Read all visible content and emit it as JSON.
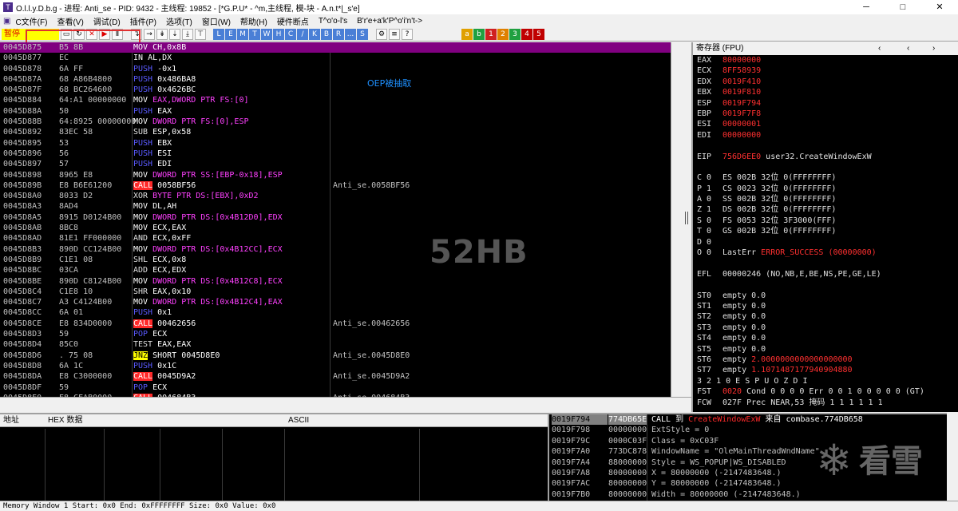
{
  "window": {
    "title": "O.l.l.y.D.b.g - 进程: Anti_se - PID: 9432 - 主线程: 19852 - [*G.P.U* - ^m,主线程, 模-块 - A.n.t*|_s'e]",
    "minimize": "─",
    "maximize": "□",
    "close": "✕"
  },
  "menu": {
    "items": [
      "C文件(F)",
      "查看(V)",
      "调试(D)",
      "插件(P)",
      "选项(T)",
      "窗口(W)",
      "帮助(H)",
      "硬件断点",
      "T^o'o-l's",
      "B'r'e+a'k'P^o'i'n't->"
    ]
  },
  "toolbar": {
    "status": "暂停",
    "letters": [
      "L",
      "E",
      "M",
      "T",
      "W",
      "H",
      "C",
      "/",
      "K",
      "B",
      "R",
      "...",
      "S"
    ],
    "colored": [
      "a",
      "b",
      "1",
      "2",
      "3",
      "4",
      "5"
    ]
  },
  "disasm": {
    "annotation": "OEP被抽取",
    "watermark": "52HB",
    "rows": [
      {
        "addr": "0045D875",
        "hex": "B5 8B",
        "mn": "MOV",
        "ops": "CH,0x8B",
        "cmt": "",
        "cls": "mov",
        "sel": true
      },
      {
        "addr": "0045D877",
        "hex": "EC",
        "mn": "IN",
        "ops": "AL,DX",
        "cmt": "",
        "cls": "mov"
      },
      {
        "addr": "0045D878",
        "hex": "6A FF",
        "mn": "PUSH",
        "ops": "-0x1",
        "cmt": "",
        "cls": "push"
      },
      {
        "addr": "0045D87A",
        "hex": "68 A86B4800",
        "mn": "PUSH",
        "ops": "0x486BA8",
        "cmt": "",
        "cls": "push"
      },
      {
        "addr": "0045D87F",
        "hex": "68 BC264600",
        "mn": "PUSH",
        "ops": "0x4626BC",
        "cmt": "",
        "cls": "push"
      },
      {
        "addr": "0045D884",
        "hex": "64:A1 00000000",
        "mn": "MOV",
        "ops": "EAX,DWORD PTR FS:[0]",
        "cmt": "",
        "cls": "mov",
        "mem": true
      },
      {
        "addr": "0045D88A",
        "hex": "50",
        "mn": "PUSH",
        "ops": "EAX",
        "cmt": "",
        "cls": "push"
      },
      {
        "addr": "0045D88B",
        "hex": "64:8925 00000000",
        "mn": "MOV",
        "ops": "DWORD PTR FS:[0],ESP",
        "cmt": "",
        "cls": "mov",
        "mem": true
      },
      {
        "addr": "0045D892",
        "hex": "83EC 58",
        "mn": "SUB",
        "ops": "ESP,0x58",
        "cmt": "",
        "cls": "sub"
      },
      {
        "addr": "0045D895",
        "hex": "53",
        "mn": "PUSH",
        "ops": "EBX",
        "cmt": "",
        "cls": "push"
      },
      {
        "addr": "0045D896",
        "hex": "56",
        "mn": "PUSH",
        "ops": "ESI",
        "cmt": "",
        "cls": "push"
      },
      {
        "addr": "0045D897",
        "hex": "57",
        "mn": "PUSH",
        "ops": "EDI",
        "cmt": "",
        "cls": "push"
      },
      {
        "addr": "0045D898",
        "hex": "8965 E8",
        "mn": "MOV",
        "ops": "DWORD PTR SS:[EBP-0x18],ESP",
        "cmt": "",
        "cls": "mov",
        "mem": true
      },
      {
        "addr": "0045D89B",
        "hex": "E8 B6E61200",
        "mn": "CALL",
        "ops": "0058BF56",
        "cmt": "Anti_se.0058BF56",
        "cls": "call"
      },
      {
        "addr": "0045D8A0",
        "hex": "8033 D2",
        "mn": "XOR",
        "ops": "BYTE PTR DS:[EBX],0xD2",
        "cmt": "",
        "cls": "xor",
        "mem": true
      },
      {
        "addr": "0045D8A3",
        "hex": "8AD4",
        "mn": "MOV",
        "ops": "DL,AH",
        "cmt": "",
        "cls": "mov"
      },
      {
        "addr": "0045D8A5",
        "hex": "8915 D0124B00",
        "mn": "MOV",
        "ops": "DWORD PTR DS:[0x4B12D0],EDX",
        "cmt": "",
        "cls": "mov",
        "mem": true
      },
      {
        "addr": "0045D8AB",
        "hex": "8BC8",
        "mn": "MOV",
        "ops": "ECX,EAX",
        "cmt": "",
        "cls": "mov"
      },
      {
        "addr": "0045D8AD",
        "hex": "81E1 FF000000",
        "mn": "AND",
        "ops": "ECX,0xFF",
        "cmt": "",
        "cls": "and"
      },
      {
        "addr": "0045D8B3",
        "hex": "890D CC124B00",
        "mn": "MOV",
        "ops": "DWORD PTR DS:[0x4B12CC],ECX",
        "cmt": "",
        "cls": "mov",
        "mem": true
      },
      {
        "addr": "0045D8B9",
        "hex": "C1E1 08",
        "mn": "SHL",
        "ops": "ECX,0x8",
        "cmt": "",
        "cls": "shl"
      },
      {
        "addr": "0045D8BC",
        "hex": "03CA",
        "mn": "ADD",
        "ops": "ECX,EDX",
        "cmt": "",
        "cls": "add"
      },
      {
        "addr": "0045D8BE",
        "hex": "890D C8124B00",
        "mn": "MOV",
        "ops": "DWORD PTR DS:[0x4B12C8],ECX",
        "cmt": "",
        "cls": "mov",
        "mem": true
      },
      {
        "addr": "0045D8C4",
        "hex": "C1E8 10",
        "mn": "SHR",
        "ops": "EAX,0x10",
        "cmt": "",
        "cls": "shr"
      },
      {
        "addr": "0045D8C7",
        "hex": "A3 C4124B00",
        "mn": "MOV",
        "ops": "DWORD PTR DS:[0x4B12C4],EAX",
        "cmt": "",
        "cls": "mov",
        "mem": true
      },
      {
        "addr": "0045D8CC",
        "hex": "6A 01",
        "mn": "PUSH",
        "ops": "0x1",
        "cmt": "",
        "cls": "push"
      },
      {
        "addr": "0045D8CE",
        "hex": "E8 834D0000",
        "mn": "CALL",
        "ops": "00462656",
        "cmt": "Anti_se.00462656",
        "cls": "call"
      },
      {
        "addr": "0045D8D3",
        "hex": "59",
        "mn": "POP",
        "ops": "ECX",
        "cmt": "",
        "cls": "push"
      },
      {
        "addr": "0045D8D4",
        "hex": "85C0",
        "mn": "TEST",
        "ops": "EAX,EAX",
        "cmt": "",
        "cls": "test"
      },
      {
        "addr": "0045D8D6",
        "hex": ". 75 08",
        "mn": "JNZ",
        "ops": "SHORT 0045D8E0",
        "cmt": "Anti_se.0045D8E0",
        "cls": "jnz"
      },
      {
        "addr": "0045D8D8",
        "hex": "6A 1C",
        "mn": "PUSH",
        "ops": "0x1C",
        "cmt": "",
        "cls": "push"
      },
      {
        "addr": "0045D8DA",
        "hex": "E8 C3000000",
        "mn": "CALL",
        "ops": "0045D9A2",
        "cmt": "Anti_se.0045D9A2",
        "cls": "call"
      },
      {
        "addr": "0045D8DF",
        "hex": "59",
        "mn": "POP",
        "ops": "ECX",
        "cmt": "",
        "cls": "push"
      },
      {
        "addr": "0045D8E0",
        "hex": "E8 CEAB0000",
        "mn": "CALL",
        "ops": "004684B3",
        "cmt": "Anti_se.004684B3",
        "cls": "call"
      }
    ]
  },
  "registers": {
    "header": "寄存器 (FPU)",
    "lines": [
      {
        "label": "EAX",
        "value": "80000000",
        "rest": "",
        "red": true
      },
      {
        "label": "ECX",
        "value": "8FF58939",
        "rest": "",
        "red": true
      },
      {
        "label": "EDX",
        "value": "0019F410",
        "rest": "",
        "red": true
      },
      {
        "label": "EBX",
        "value": "0019F810",
        "rest": "",
        "red": true
      },
      {
        "label": "ESP",
        "value": "0019F794",
        "rest": "",
        "red": true
      },
      {
        "label": "EBP",
        "value": "0019F7F8",
        "rest": "",
        "red": true
      },
      {
        "label": "ESI",
        "value": "00000001",
        "rest": "",
        "red": true
      },
      {
        "label": "EDI",
        "value": "00000000",
        "rest": "",
        "red": true
      },
      {
        "label": "",
        "value": "",
        "rest": ""
      },
      {
        "label": "EIP",
        "value": "756D6EE0",
        "rest": "user32.CreateWindowExW",
        "red": true
      },
      {
        "label": "",
        "value": "",
        "rest": ""
      },
      {
        "label": "C 0",
        "value": "",
        "rest": "ES 002B 32位 0(FFFFFFFF)"
      },
      {
        "label": "P 1",
        "value": "",
        "rest": "CS 0023 32位 0(FFFFFFFF)"
      },
      {
        "label": "A 0",
        "value": "",
        "rest": "SS 002B 32位 0(FFFFFFFF)"
      },
      {
        "label": "Z 1",
        "value": "",
        "rest": "DS 002B 32位 0(FFFFFFFF)"
      },
      {
        "label": "S 0",
        "value": "",
        "rest": "FS 0053 32位 3F3000(FFF)"
      },
      {
        "label": "T 0",
        "value": "",
        "rest": "GS 002B 32位 0(FFFFFFFF)"
      },
      {
        "label": "D 0",
        "value": "",
        "rest": ""
      },
      {
        "label": "O 0",
        "value": "",
        "rest": "LastErr",
        "tail": "ERROR_SUCCESS (00000000)"
      },
      {
        "label": "",
        "value": "",
        "rest": ""
      },
      {
        "label": "EFL",
        "value": "",
        "rest": "00000246 (NO,NB,E,BE,NS,PE,GE,LE)"
      },
      {
        "label": "",
        "value": "",
        "rest": ""
      },
      {
        "label": "ST0",
        "value": "",
        "rest": "empty 0.0"
      },
      {
        "label": "ST1",
        "value": "",
        "rest": "empty 0.0"
      },
      {
        "label": "ST2",
        "value": "",
        "rest": "empty 0.0"
      },
      {
        "label": "ST3",
        "value": "",
        "rest": "empty 0.0"
      },
      {
        "label": "ST4",
        "value": "",
        "rest": "empty 0.0"
      },
      {
        "label": "ST5",
        "value": "",
        "rest": "empty 0.0"
      },
      {
        "label": "ST6",
        "value": "",
        "rest": "empty",
        "tail": "2.0000000000000000000"
      },
      {
        "label": "ST7",
        "value": "",
        "rest": "empty",
        "tail": "1.1071487177940904880"
      },
      {
        "label": "",
        "value": "",
        "rest": "              3 2 1 0      E S P U O Z D I"
      },
      {
        "label": "FST",
        "value": "0020",
        "rest": "Cond 0 0 0 0  Err 0 0 1 0 0 0 0 0  (GT)",
        "red": true
      },
      {
        "label": "FCW",
        "value": "",
        "rest": "027F  Prec NEAR,53  掩码    1 1 1 1 1 1"
      }
    ]
  },
  "dump": {
    "col_addr": "地址",
    "col_hex": "HEX 数据",
    "col_ascii": "ASCII"
  },
  "stack": {
    "rows": [
      {
        "addr": "0019F794",
        "val": "774DB65E",
        "cmt": "CALL 到",
        "red": "CreateWindowExW",
        "tail": "来自 combase.774DB658",
        "sel": true
      },
      {
        "addr": "0019F798",
        "val": "00000000",
        "cmt": "ExtStyle = 0"
      },
      {
        "addr": "0019F79C",
        "val": "0000C03F",
        "cmt": "Class = 0xC03F"
      },
      {
        "addr": "0019F7A0",
        "val": "773DC878",
        "cmt": "WindowName = \"OleMainThreadWndName\""
      },
      {
        "addr": "0019F7A4",
        "val": "88000000",
        "cmt": "Style = WS_POPUP|WS_DISABLED"
      },
      {
        "addr": "0019F7A8",
        "val": "80000000",
        "cmt": "X = 80000000 (-2147483648.)"
      },
      {
        "addr": "0019F7AC",
        "val": "80000000",
        "cmt": "Y = 80000000 (-2147483648.)"
      },
      {
        "addr": "0019F7B0",
        "val": "80000000",
        "cmt": "Width = 80000000 (-2147483648.)"
      }
    ],
    "watermark_text": "看雪"
  },
  "status": {
    "text": "Memory Window 1  Start: 0x0  End: 0xFFFFFFFF  Size: 0x0 Value: 0x0"
  }
}
